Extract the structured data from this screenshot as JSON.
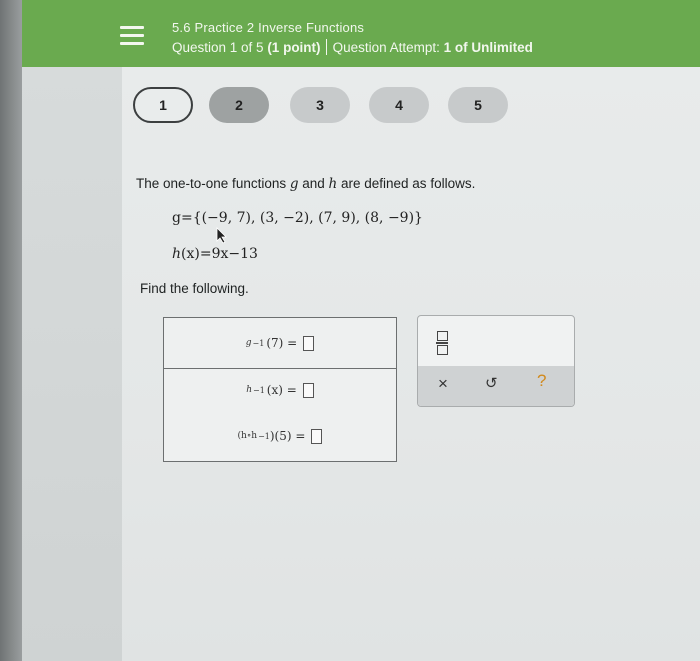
{
  "header": {
    "title": "5.6 Practice 2 Inverse Functions",
    "question_prefix": "Question 1 of 5 ",
    "question_points": "(1 point)",
    "attempt_prefix": "Question Attempt: ",
    "attempt_value": "1 of Unlimited"
  },
  "question_nav": [
    "1",
    "2",
    "3",
    "4",
    "5"
  ],
  "problem": {
    "intro_a": "The one-to-one functions ",
    "g": "g",
    "intro_and": " and ",
    "h": "h",
    "intro_b": " are defined as follows.",
    "g_def": "g={(−9, 7), (3, −2), (7, 9), (8, −9)}",
    "h_def_lhs": "h",
    "h_def_rest": "(x)=9x−13",
    "find_text": "Find the following."
  },
  "answers": {
    "row1_fn": "g",
    "row1_arg": "(7) =",
    "row2_fn": "h",
    "row2_arg": "(x) =",
    "row3_expr": "(h∘h",
    "row3_arg": ")(5) ="
  },
  "toolbox": {
    "clear_glyph": "×",
    "undo_glyph": "↺",
    "help_glyph": "?"
  },
  "colors": {
    "header_green": "#6aaa4f",
    "help_orange": "#d18a1e"
  }
}
